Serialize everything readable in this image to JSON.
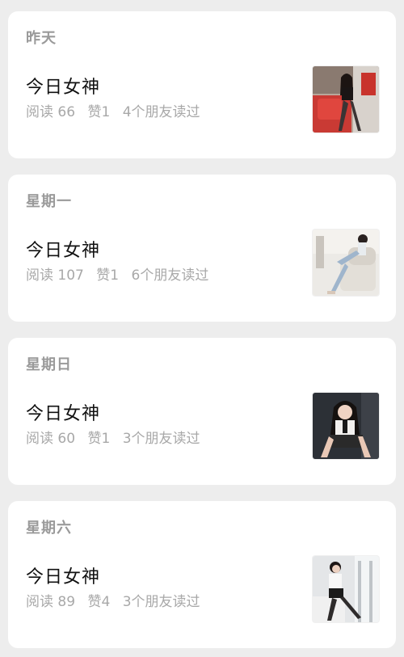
{
  "articles": [
    {
      "date": "昨天",
      "title": "今日女神",
      "read_label": "阅读 66",
      "like_label": "赞1",
      "friends_label": "4个朋友读过",
      "thumbnail_icon": "photo-woman-red-chair"
    },
    {
      "date": "星期一",
      "title": "今日女神",
      "read_label": "阅读 107",
      "like_label": "赞1",
      "friends_label": "6个朋友读过",
      "thumbnail_icon": "photo-woman-white-sofa"
    },
    {
      "date": "星期日",
      "title": "今日女神",
      "read_label": "阅读 60",
      "like_label": "赞1",
      "friends_label": "3个朋友读过",
      "thumbnail_icon": "photo-woman-dark-portrait"
    },
    {
      "date": "星期六",
      "title": "今日女神",
      "read_label": "阅读 89",
      "like_label": "赞4",
      "friends_label": "3个朋友读过",
      "thumbnail_icon": "photo-woman-white-room"
    }
  ],
  "colors": {
    "background": "#ededed",
    "card": "#ffffff",
    "date_text": "#9a9a9a",
    "meta_text": "#a8a8a8",
    "title_text": "#111111"
  }
}
